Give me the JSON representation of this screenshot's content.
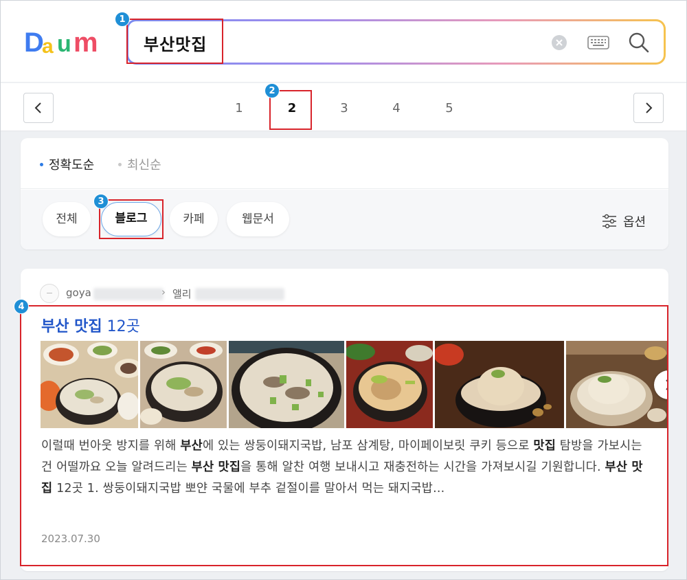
{
  "logo": {
    "alt": "Daum"
  },
  "search": {
    "query": "부산맛집"
  },
  "icons": {
    "clear": "clear-icon",
    "keyboard": "keyboard-icon",
    "search": "search-icon"
  },
  "pagination": {
    "pages": [
      "1",
      "2",
      "3",
      "4",
      "5"
    ],
    "current": "2"
  },
  "sort": {
    "accuracy_label": "정확도순",
    "recent_label": "최신순"
  },
  "filters": {
    "chips": [
      "전체",
      "블로그",
      "카페",
      "웹문서"
    ],
    "active": "블로그",
    "option_label": "옵션"
  },
  "result": {
    "source_name": "goya",
    "source_category": "앨리",
    "title_prefix": "부산 맛집",
    "title_suffix": " 12곳",
    "snippet": [
      {
        "t": "이럴때 번아웃 방지를 위해 "
      },
      {
        "b": "부산"
      },
      {
        "t": "에 있는 쌍둥이돼지국밥, 남포 삼계탕, 마이페이보릿 쿠키 등으로 "
      },
      {
        "b": "맛집"
      },
      {
        "t": " 탐방을 가보시는건 어떨까요 오늘 알려드리는 "
      },
      {
        "b": "부산 맛집"
      },
      {
        "t": "을 통해 알찬 여행 보내시고 재충전하는 시간을 가져보시길 기원합니다. "
      },
      {
        "b": "부산 맛집"
      },
      {
        "t": " 12곳 1. 쌍둥이돼지국밥 뽀얀 국물에 부추 겉절이를 말아서 먹는 돼지국밥..."
      }
    ],
    "date": "2023.07.30"
  },
  "annotations": [
    "1",
    "2",
    "3",
    "4"
  ],
  "colors": {
    "accent_blue": "#2156c9",
    "highlight_red": "#d8232a",
    "badge_blue": "#1f8fd6"
  }
}
